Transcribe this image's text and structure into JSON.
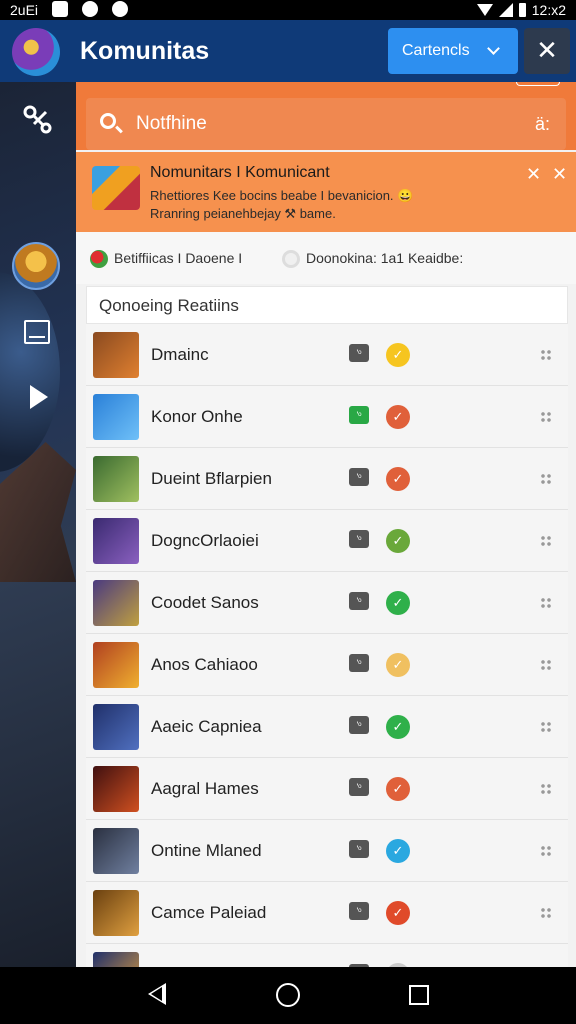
{
  "status_bar": {
    "left_text": "2uEi",
    "time": "12:x2"
  },
  "app_bar": {
    "title": "Komunitas",
    "contents_button": "Cartencls",
    "close_symbol": "✕"
  },
  "search": {
    "placeholder": "Notfhine",
    "right_icon": "ä:"
  },
  "banner": {
    "title": "Nomunitars I Komunicant",
    "line1": "Rhettiores Kee bocins beabe I bevanicion. 😀",
    "line2": "Rranring peianehbejay ⚒ bame.",
    "close1": "✕",
    "close2": "✕"
  },
  "filters": {
    "item1": "Betiffiicas I Daoene I",
    "item2": "Doonokina: 1a1 Keaidbe:"
  },
  "section": {
    "title": "Qonoeing Reatiins"
  },
  "rows": [
    {
      "label": "Dmainc",
      "thumb": [
        "#8a4a20",
        "#e08030"
      ],
      "tag": "green-false",
      "status": "#f6c520",
      "status_glyph": "✓"
    },
    {
      "label": "Konor Onhe",
      "thumb": [
        "#2a80d8",
        "#6fc0f8"
      ],
      "tag": "green-true",
      "status": "#e0603a",
      "status_glyph": "✓"
    },
    {
      "label": "Dueint Bflarpien",
      "thumb": [
        "#3a6a30",
        "#a0c060"
      ],
      "tag": "green-false",
      "status": "#e0603a",
      "status_glyph": "✓"
    },
    {
      "label": "DogncOrlaoiei",
      "thumb": [
        "#3a2a70",
        "#8a60c0"
      ],
      "tag": "green-false",
      "status": "#6aa83a",
      "status_glyph": "✓"
    },
    {
      "label": "Coodet Sanos",
      "thumb": [
        "#4a3a80",
        "#c0a040"
      ],
      "tag": "green-false",
      "status": "#2fb04a",
      "status_glyph": "✓"
    },
    {
      "label": "Anos Cahiaoo",
      "thumb": [
        "#b04020",
        "#f0b030"
      ],
      "tag": "green-false",
      "status": "#f0c060",
      "status_glyph": "✓"
    },
    {
      "label": "Aaeic Capniea",
      "thumb": [
        "#20306a",
        "#5070c0"
      ],
      "tag": "green-false",
      "status": "#2fb04a",
      "status_glyph": "✓"
    },
    {
      "label": "Aagral Hames",
      "thumb": [
        "#401010",
        "#d05020"
      ],
      "tag": "green-false",
      "status": "#e0603a",
      "status_glyph": "✓"
    },
    {
      "label": "Ontine Mlaned",
      "thumb": [
        "#2a3040",
        "#7080a0"
      ],
      "tag": "green-false",
      "status": "#2aa8e0",
      "status_glyph": "✓"
    },
    {
      "label": "Camce Paleiad",
      "thumb": [
        "#6a4010",
        "#e0a040"
      ],
      "tag": "green-false",
      "status": "#e04a2a",
      "status_glyph": "✓"
    },
    {
      "label": "",
      "thumb": [
        "#20306a",
        "#e0a040"
      ],
      "tag": "green-false",
      "status": "#cccccc",
      "status_glyph": ""
    }
  ],
  "tag_text": "ʹᵒ"
}
